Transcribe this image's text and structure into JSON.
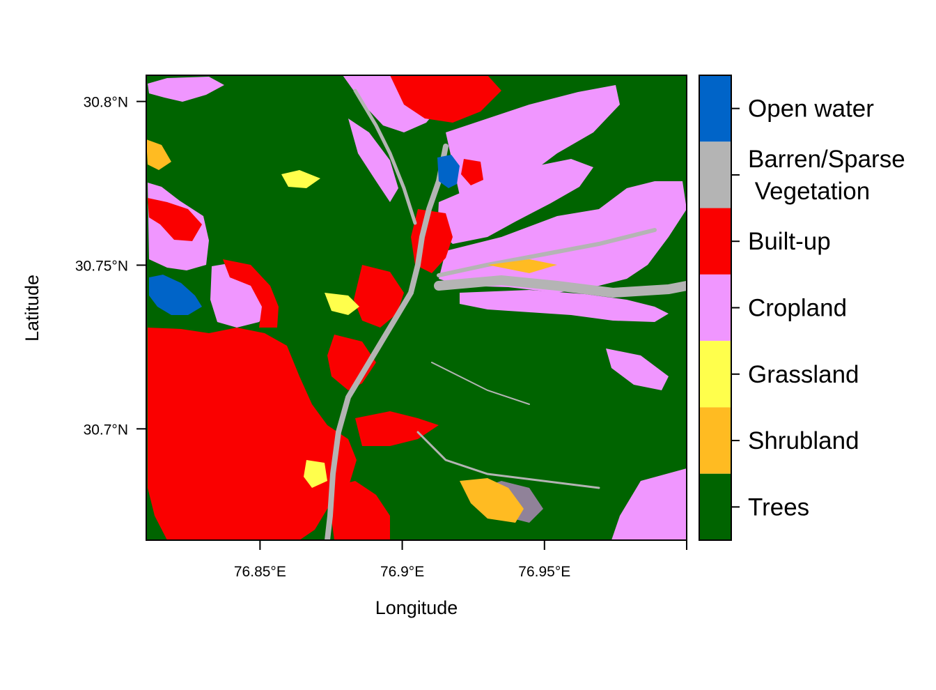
{
  "map": {
    "xlabel": "Longitude",
    "ylabel": "Latitude",
    "x_range": [
      76.81,
      77.0
    ],
    "y_range": [
      30.666,
      30.808
    ],
    "x_ticks": [
      {
        "value": 76.85,
        "label": "76.85°E"
      },
      {
        "value": 76.9,
        "label": "76.9°E"
      },
      {
        "value": 76.95,
        "label": "76.95°E"
      },
      {
        "value": 77.0,
        "label": ""
      }
    ],
    "y_ticks": [
      {
        "value": 30.8,
        "label": "30.8°N"
      },
      {
        "value": 30.75,
        "label": "30.75°N"
      },
      {
        "value": 30.7,
        "label": "30.7°N"
      }
    ]
  },
  "legend": {
    "classes": [
      {
        "lines": [
          "Open water"
        ],
        "color": "#0064c8"
      },
      {
        "lines": [
          "Barren/Sparse",
          " Vegetation"
        ],
        "color": "#b4b4b4"
      },
      {
        "lines": [
          "Built-up"
        ],
        "color": "#fa0000"
      },
      {
        "lines": [
          "Cropland"
        ],
        "color": "#f096ff"
      },
      {
        "lines": [
          "Grassland"
        ],
        "color": "#ffff4c"
      },
      {
        "lines": [
          "Shrubland"
        ],
        "color": "#ffbb22"
      },
      {
        "lines": [
          "Trees"
        ],
        "color": "#006400"
      }
    ]
  }
}
